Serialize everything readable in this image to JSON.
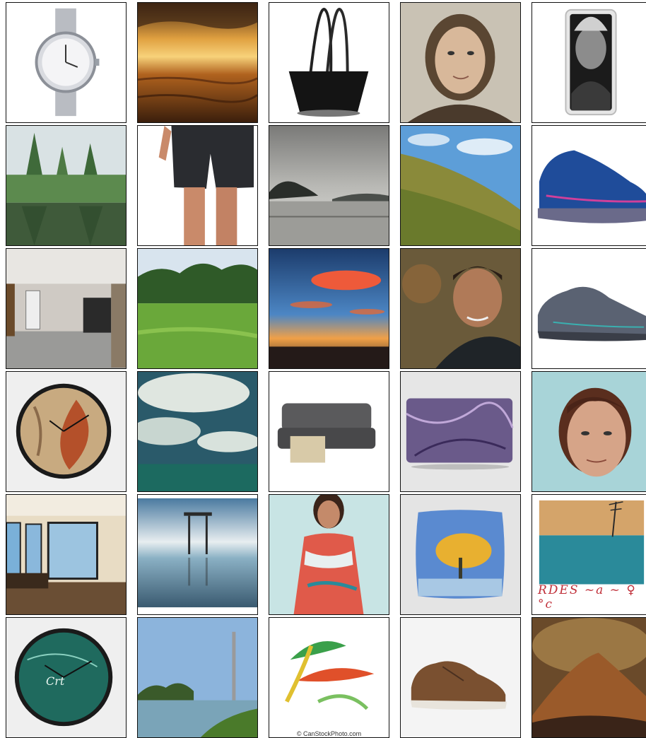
{
  "tiles": [
    {
      "subject": "luxury wristwatch on white background"
    },
    {
      "subject": "golden sunset over sea waves"
    },
    {
      "subject": "black leather tote handbag"
    },
    {
      "subject": "portrait of a man with long braided hair"
    },
    {
      "subject": "black and white portrait phone case"
    },
    {
      "subject": "trees reflected in a lake"
    },
    {
      "subject": "man wearing dark athletic shorts"
    },
    {
      "subject": "misty lake landscape"
    },
    {
      "subject": "grassy hillside under blue sky"
    },
    {
      "subject": "blue running shoe"
    },
    {
      "subject": "empty room with open doorway"
    },
    {
      "subject": "green field with forest"
    },
    {
      "subject": "red clouds at sunset"
    },
    {
      "subject": "smiling man in dark jacket"
    },
    {
      "subject": "grey trail running shoe"
    },
    {
      "subject": "wall clock with autumn leaf print"
    },
    {
      "subject": "dramatic clouds over teal sea"
    },
    {
      "subject": "grey sectional sofa with ottoman"
    },
    {
      "subject": "purple abstract laptop sleeve"
    },
    {
      "subject": "portrait of a man with brown hair"
    },
    {
      "subject": "modern room with large windows"
    },
    {
      "subject": "wooden table standing in water"
    },
    {
      "subject": "woman in colorful sleeveless dress"
    },
    {
      "subject": "throw pillow with painted tree print"
    },
    {
      "subject": "painted seascape with tree"
    },
    {
      "subject": "wall clock with teal ocean print"
    },
    {
      "subject": "lake with tower and palm trees"
    },
    {
      "subject": "colorful tropical leaves illustration"
    },
    {
      "subject": "brown leather sneaker"
    },
    {
      "subject": "painted mountain landscape"
    }
  ],
  "captions": {
    "handwriting": "RDES ~a ~ ♀ °c",
    "watermark": "© CanStockPhoto.com",
    "clock_logo": "Crt"
  },
  "colors": {
    "tile_border": "#111111",
    "background": "#ffffff"
  }
}
